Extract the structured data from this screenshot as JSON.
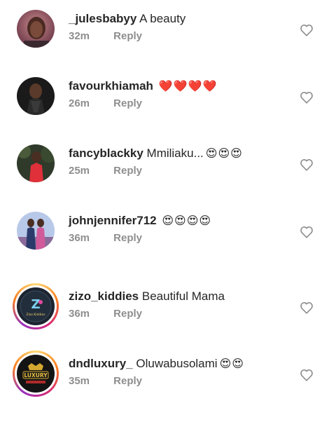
{
  "colors": {
    "text": "#262626",
    "muted": "#8e8e8e",
    "heart_red": "#ed4956"
  },
  "comments": [
    {
      "username": "_julesbabyy",
      "text": "A beauty",
      "emojis": "",
      "time": "32m",
      "reply_label": "Reply",
      "story_ring": false,
      "like_icon": "heart-outline-icon"
    },
    {
      "username": "favourkhiamah",
      "text": "",
      "emojis": "❤️❤️❤️❤️",
      "time": "26m",
      "reply_label": "Reply",
      "story_ring": false,
      "like_icon": "heart-outline-icon"
    },
    {
      "username": "fancyblackky",
      "text": "Mmiliaku...",
      "emojis": "😍😍😍",
      "time": "25m",
      "reply_label": "Reply",
      "story_ring": false,
      "like_icon": "heart-outline-icon"
    },
    {
      "username": "johnjennifer712",
      "text": "",
      "emojis": "😍😍😍😍",
      "time": "36m",
      "reply_label": "Reply",
      "story_ring": false,
      "like_icon": "heart-outline-icon"
    },
    {
      "username": "zizo_kiddies",
      "text": "Beautiful  Mama",
      "emojis": "",
      "time": "36m",
      "reply_label": "Reply",
      "story_ring": true,
      "avatar_logo_text": "Zizo Kiddies",
      "like_icon": "heart-outline-icon"
    },
    {
      "username": "dndluxury_",
      "text": "Oluwabusolami",
      "emojis": "😍😍",
      "time": "35m",
      "reply_label": "Reply",
      "story_ring": true,
      "avatar_logo_text": "LUXURY",
      "like_icon": "heart-outline-icon"
    }
  ]
}
